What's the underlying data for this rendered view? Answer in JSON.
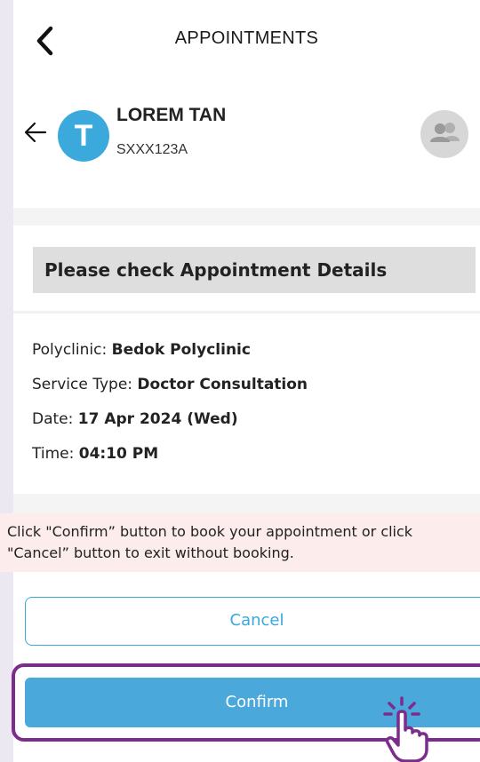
{
  "header": {
    "title": "APPOINTMENTS",
    "back_icon": "chevron-left-icon"
  },
  "patient": {
    "initial": "T",
    "name": "LOREM TAN",
    "id": "SXXX123A",
    "avatar_color": "#3ba9dc",
    "switch_icon": "users-icon"
  },
  "section": {
    "heading": "Please check Appointment Details"
  },
  "details": [
    {
      "label": "Polyclinic: ",
      "value": "Bedok Polyclinic"
    },
    {
      "label": "Service Type: ",
      "value": "Doctor Consultation"
    },
    {
      "label": "Date: ",
      "value": "17 Apr 2024 (Wed)"
    },
    {
      "label": "Time: ",
      "value": "04:10 PM"
    }
  ],
  "notice": {
    "text": "Click \"Confirm” button to book your appointment or click \"Cancel” button to exit without booking."
  },
  "actions": {
    "cancel_label": "Cancel",
    "confirm_label": "Confirm"
  },
  "colors": {
    "accent": "#3aa7dd",
    "highlight": "#7b2c8c",
    "notice_bg": "#fcecec"
  }
}
